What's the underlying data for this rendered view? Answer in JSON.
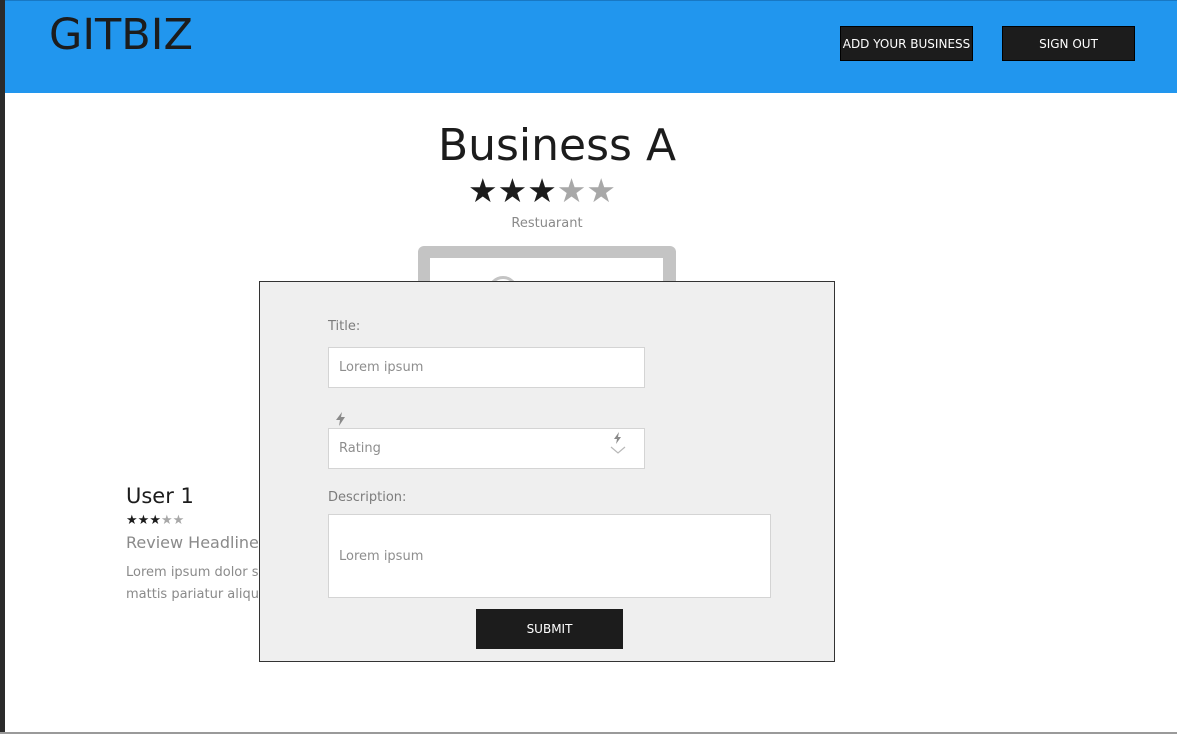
{
  "header": {
    "logo": "GITBIZ",
    "add_business_label": "ADD YOUR BUSINESS",
    "sign_out_label": "SIGN OUT",
    "background_color": "#2196ee"
  },
  "business": {
    "name": "Business A",
    "rating": 3,
    "rating_max": 5,
    "category": "Restuarant"
  },
  "review": {
    "user": "User 1",
    "rating": 3,
    "rating_max": 5,
    "headline": "Review Headline",
    "body": "Lorem ipsum dolor si praesent at id quisqu eros quis aliquam wis mattis pariatur aliqua"
  },
  "modal": {
    "title_label": "Title:",
    "title_placeholder": "Lorem ipsum",
    "rating_placeholder": "Rating",
    "rating_icon": "lightning-icon",
    "rating_dropdown_icon": "chevron-down-icon",
    "description_label": "Description:",
    "description_placeholder": "Lorem ipsum",
    "submit_label": "SUBMIT"
  }
}
